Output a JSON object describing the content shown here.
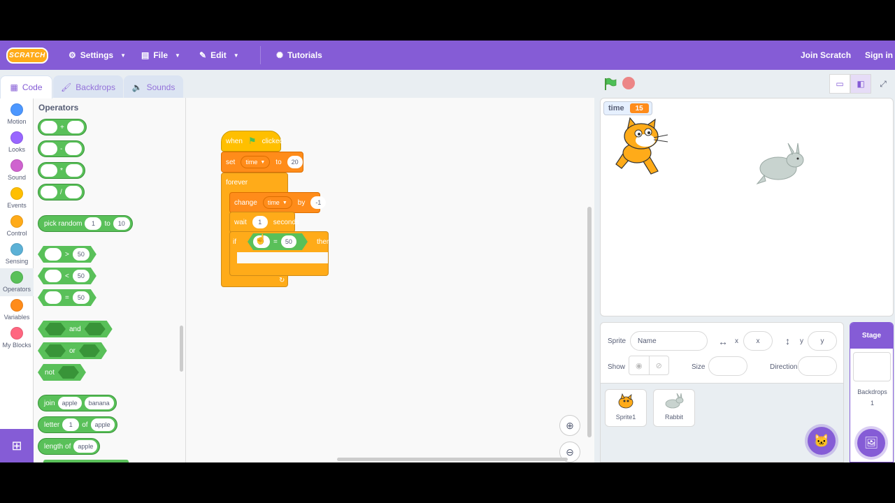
{
  "menubar": {
    "logo": "SCRATCH",
    "settings": "Settings",
    "file": "File",
    "edit": "Edit",
    "tutorials": "Tutorials",
    "join": "Join Scratch",
    "signin": "Sign in"
  },
  "tabs": {
    "code": "Code",
    "backdrops": "Backdrops",
    "sounds": "Sounds"
  },
  "categories": [
    {
      "label": "Motion",
      "color": "#4c97ff"
    },
    {
      "label": "Looks",
      "color": "#9966ff"
    },
    {
      "label": "Sound",
      "color": "#cf63cf"
    },
    {
      "label": "Events",
      "color": "#ffbf00"
    },
    {
      "label": "Control",
      "color": "#ffab19"
    },
    {
      "label": "Sensing",
      "color": "#5cb1d6"
    },
    {
      "label": "Operators",
      "color": "#59c059"
    },
    {
      "label": "Variables",
      "color": "#ff8c1a"
    },
    {
      "label": "My Blocks",
      "color": "#ff6680"
    }
  ],
  "palette": {
    "title": "Operators",
    "add_op": "+",
    "sub_op": "-",
    "mul_op": "*",
    "div_op": "/",
    "random": {
      "label1": "pick random",
      "from": "1",
      "label2": "to",
      "to": "10"
    },
    "gt": {
      "op": ">",
      "value": "50"
    },
    "lt": {
      "op": "<",
      "value": "50"
    },
    "eq": {
      "op": "=",
      "value": "50"
    },
    "and": "and",
    "or": "or",
    "not": "not",
    "join": {
      "label": "join",
      "a": "apple",
      "b": "banana"
    },
    "letter": {
      "label1": "letter",
      "n": "1",
      "label2": "of",
      "word": "apple"
    },
    "length": {
      "label": "length of",
      "word": "apple"
    }
  },
  "script": {
    "hat": {
      "when": "when",
      "clicked": "clicked"
    },
    "set": {
      "label": "set",
      "var": "time",
      "to": "to",
      "value": "20"
    },
    "forever": "forever",
    "change": {
      "label": "change",
      "var": "time",
      "by": "by",
      "value": "-1"
    },
    "wait": {
      "label": "wait",
      "value": "1",
      "unit": "seconds"
    },
    "if": {
      "label": "if",
      "op": "=",
      "value": "50",
      "then": "then"
    }
  },
  "stage": {
    "monitor_label": "time",
    "monitor_value": "15"
  },
  "sprite_info": {
    "sprite_label": "Sprite",
    "name_placeholder": "Name",
    "x_label": "x",
    "x_placeholder": "x",
    "y_label": "y",
    "y_placeholder": "y",
    "show_label": "Show",
    "size_label": "Size",
    "direction_label": "Direction"
  },
  "sprites": [
    {
      "name": "Sprite1"
    },
    {
      "name": "Rabbit"
    }
  ],
  "stage_pane": {
    "title": "Stage",
    "backdrops_label": "Backdrops",
    "backdrops_count": "1"
  }
}
